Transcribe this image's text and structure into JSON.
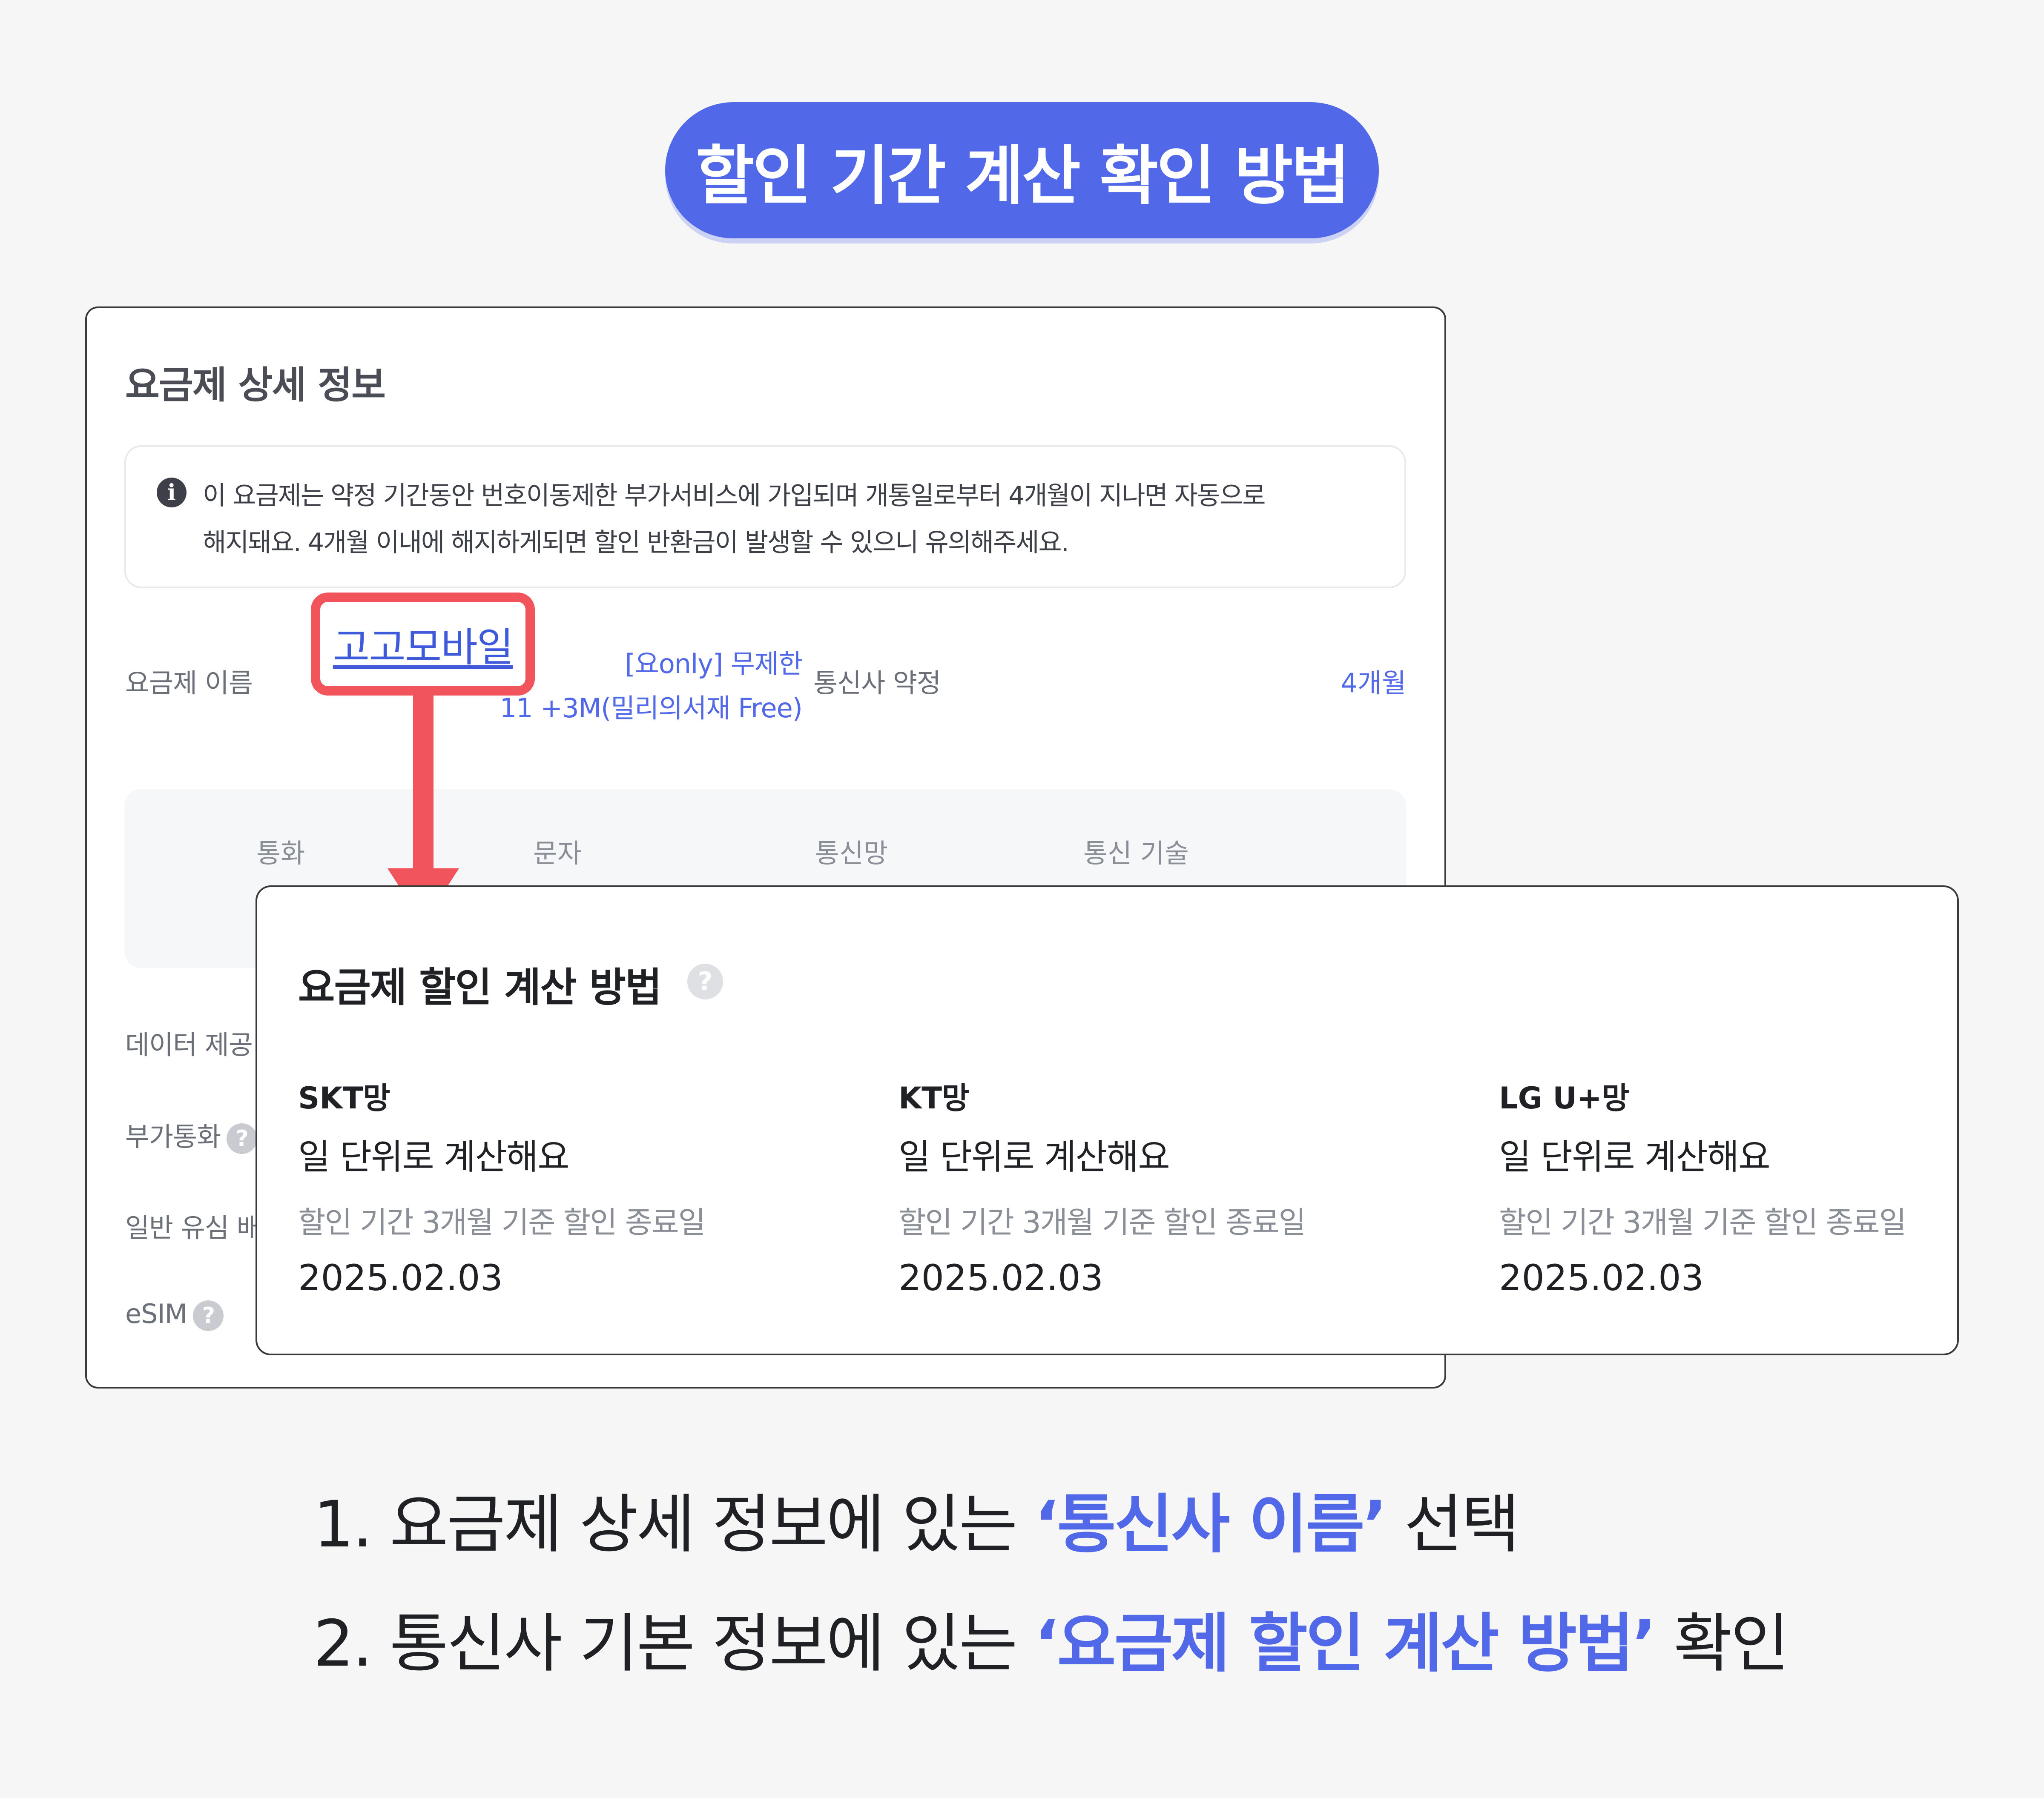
{
  "title": "할인 기간 계산 확인 방법",
  "detail": {
    "heading": "요금제 상세 정보",
    "info_icon": "info-icon",
    "info_line1": "이 요금제는 약정 기간동안 번호이동제한 부가서비스에 가입되며 개통일로부터 4개월이 지나면 자동으로",
    "info_line2": "해지돼요. 4개월 이내에 해지하게되면 할인 반환금이 발생할 수 있으니 유의해주세요.",
    "plan_name_label": "요금제 이름",
    "plan_name_line1": "[요only] 무제한",
    "plan_name_line2": "11 +3M(밀리의서재 Free)",
    "contract_label": "통신사 약정",
    "contract_value": "4개월",
    "specs": [
      "통화",
      "문자",
      "통신망",
      "통신 기술"
    ],
    "data_label": "데이터 제공",
    "extra_call_label": "부가통화",
    "usim_label": "일반 유심 배",
    "esim_label": "eSIM"
  },
  "highlight": {
    "carrier_name": "고고모바일"
  },
  "calc": {
    "title": "요금제 할인 계산 방법",
    "columns": [
      {
        "network": "SKT망",
        "method": "일 단위로 계산해요",
        "note": "할인 기간 3개월 기준 할인 종료일",
        "date": "2025.02.03"
      },
      {
        "network": "KT망",
        "method": "일 단위로 계산해요",
        "note": "할인 기간 3개월 기준 할인 종료일",
        "date": "2025.02.03"
      },
      {
        "network": "LG U+망",
        "method": "일 단위로 계산해요",
        "note": "할인 기간 3개월 기준 할인 종료일",
        "date": "2025.02.03"
      }
    ]
  },
  "steps": [
    {
      "prefix": "1. 요금제 상세 정보에 있는 ",
      "highlight": "‘통신사 이름’",
      "suffix": " 선택"
    },
    {
      "prefix": "2. 통신사 기본 정보에 있는 ",
      "highlight": "‘요금제 할인 계산 방법’",
      "suffix": " 확인"
    }
  ],
  "colors": {
    "accent": "#5169e9",
    "highlight_red": "#f2545b",
    "text_dark": "#1f2125",
    "text_grey": "#8a8e96"
  }
}
